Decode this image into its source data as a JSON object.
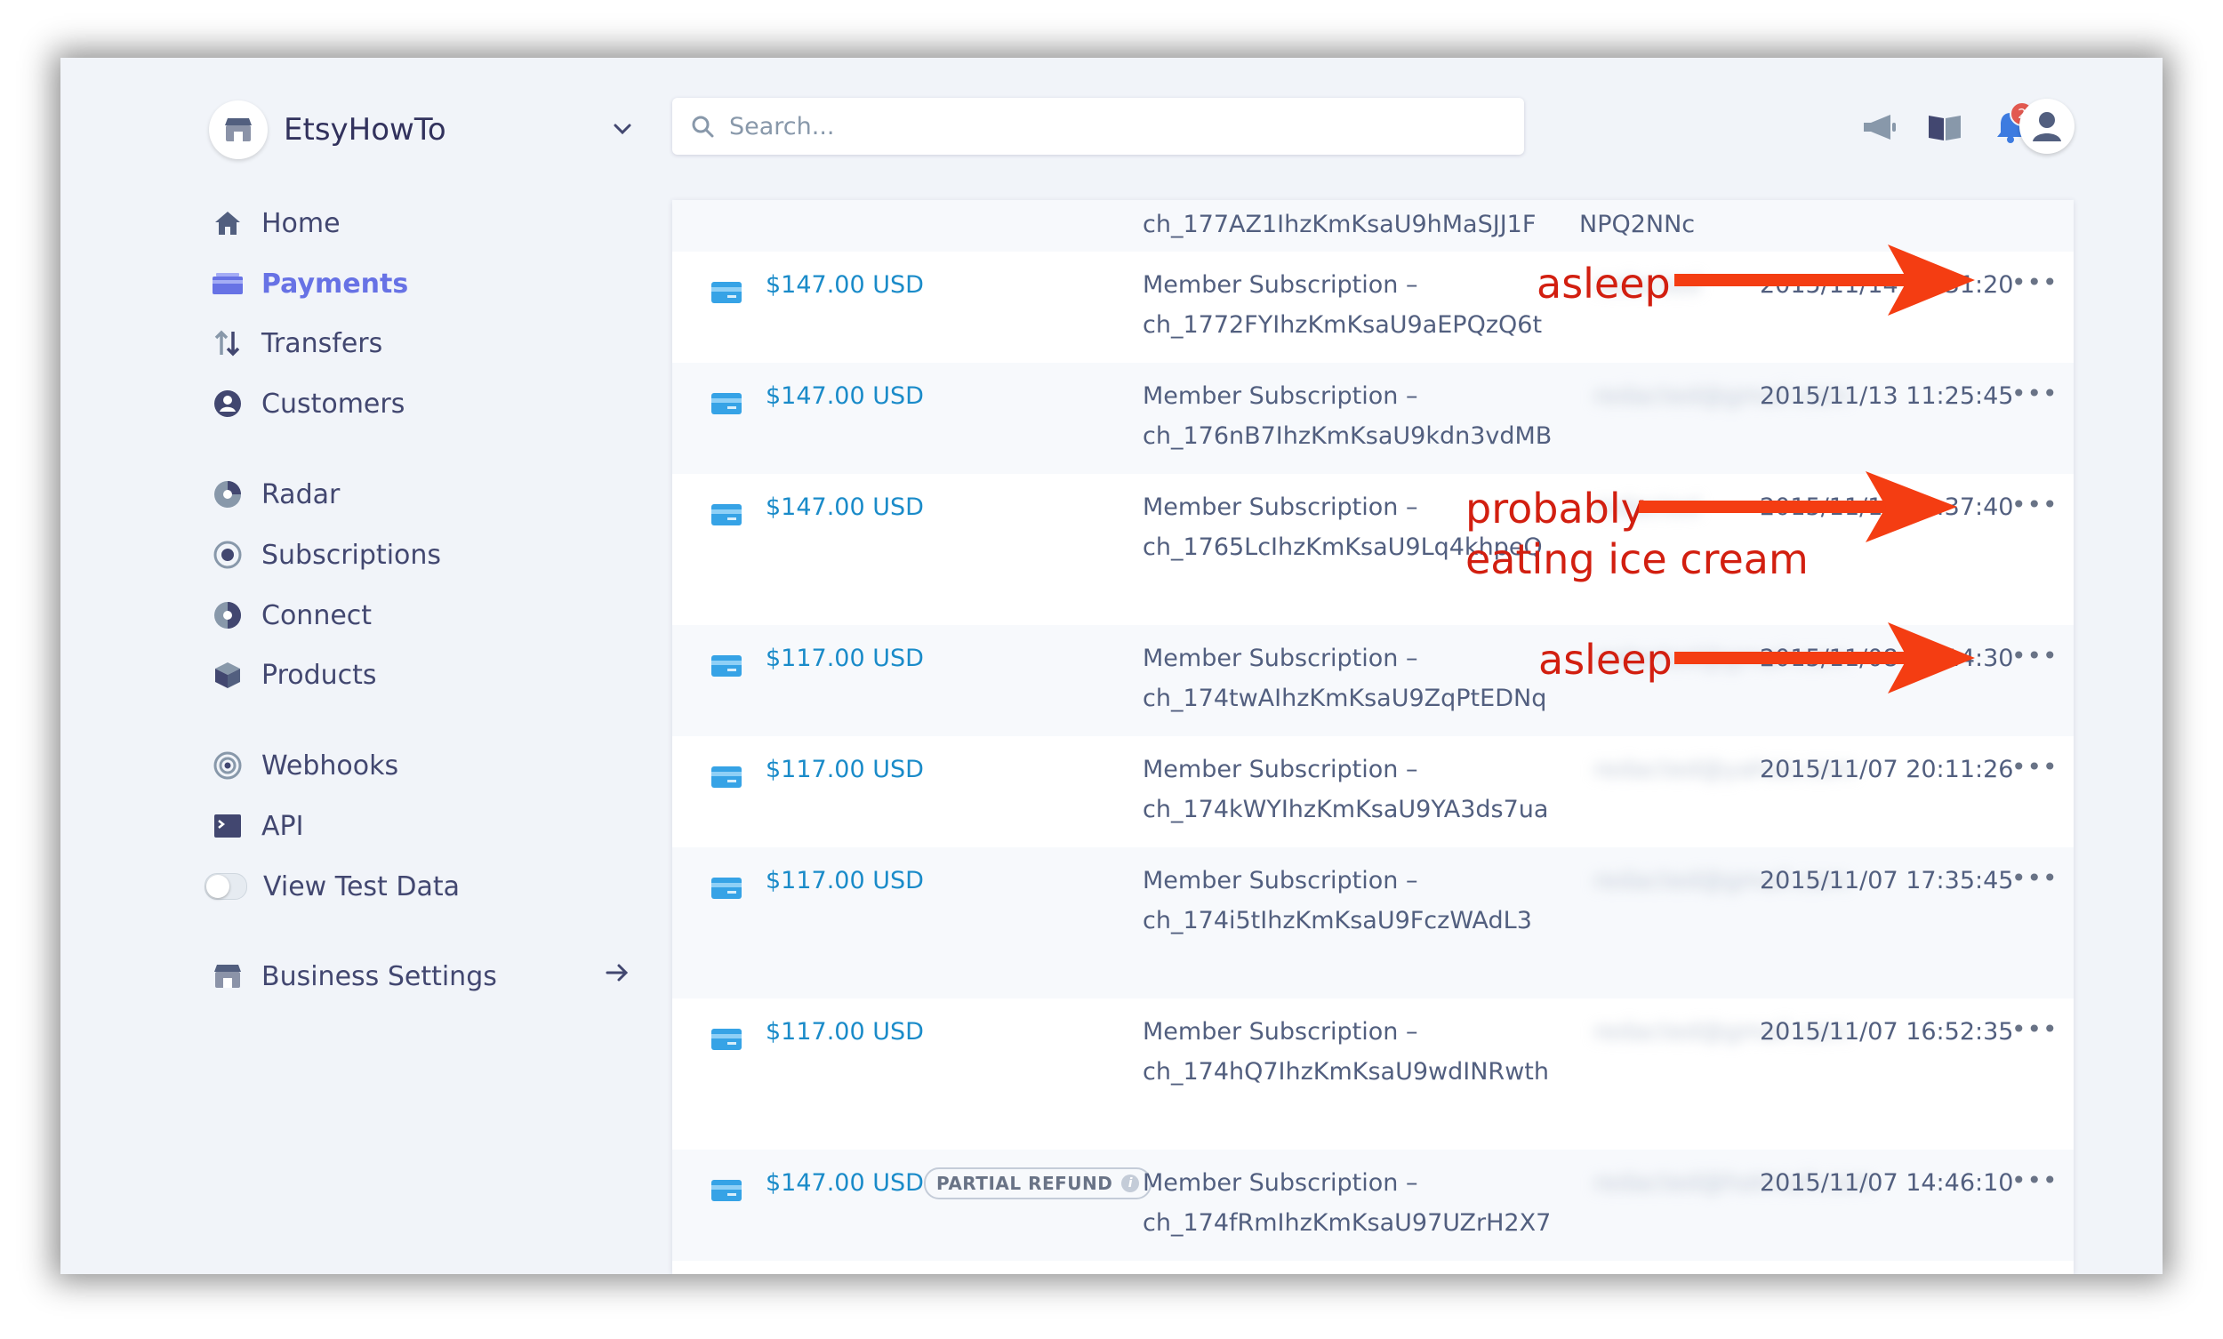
{
  "header": {
    "account_name": "EtsyHowTo",
    "search_placeholder": "Search...",
    "notification_count": "2"
  },
  "sidebar": {
    "items": [
      {
        "label": "Home",
        "icon": "home-icon"
      },
      {
        "label": "Payments",
        "icon": "payments-icon",
        "active": true
      },
      {
        "label": "Transfers",
        "icon": "transfers-icon"
      },
      {
        "label": "Customers",
        "icon": "customers-icon"
      },
      {
        "label": "Radar",
        "icon": "radar-icon"
      },
      {
        "label": "Subscriptions",
        "icon": "subscriptions-icon"
      },
      {
        "label": "Connect",
        "icon": "connect-icon"
      },
      {
        "label": "Products",
        "icon": "products-icon"
      },
      {
        "label": "Webhooks",
        "icon": "webhooks-icon"
      },
      {
        "label": "API",
        "icon": "api-icon"
      },
      {
        "label": "View Test Data",
        "icon": "toggle"
      },
      {
        "label": "Business Settings",
        "icon": "store-icon"
      }
    ]
  },
  "table": {
    "top_partial": {
      "charge_id": "ch_177AZ1IhzKmKsaU9hMaSJJ1F",
      "customer_fragment": "NPQ2NNc"
    },
    "rows": [
      {
        "amount": "$147.00 USD",
        "description": "Member Subscription –",
        "charge_id": "ch_1772FYIhzKmKsaU9aEPQzQ6t",
        "date": "2015/11/14 03:31:20",
        "customer": "redacted"
      },
      {
        "amount": "$147.00 USD",
        "description": "Member Subscription –",
        "charge_id": "ch_176nB7IhzKmKsaU9kdn3vdMB",
        "date": "2015/11/13 11:25:45",
        "customer": "redacted@gmail.com"
      },
      {
        "amount": "$147.00 USD",
        "description": "Member Subscription –",
        "charge_id": "ch_1765LcIhzKmKsaU9Lq4khpeQ",
        "date": "2015/11/11 12:37:40",
        "customer": "redacted"
      },
      {
        "amount": "$117.00 USD",
        "description": "Member Subscription –",
        "charge_id": "ch_174twAIhzKmKsaU9ZqPtEDNq",
        "date": "2015/11/08 06:14:30",
        "customer": "redacted@gmail.com"
      },
      {
        "amount": "$117.00 USD",
        "description": "Member Subscription –",
        "charge_id": "ch_174kWYIhzKmKsaU9YA3ds7ua",
        "date": "2015/11/07 20:11:26",
        "customer": "redacted@yahoo.com"
      },
      {
        "amount": "$117.00 USD",
        "description": "Member Subscription –",
        "charge_id": "ch_174i5tIhzKmKsaU9FczWAdL3",
        "date": "2015/11/07 17:35:45",
        "customer": "redacted@gmail.com"
      },
      {
        "amount": "$117.00 USD",
        "description": "Member Subscription –",
        "charge_id": "ch_174hQ7IhzKmKsaU9wdINRwth",
        "date": "2015/11/07 16:52:35",
        "customer": "redacted@gmail.com"
      },
      {
        "amount": "$147.00 USD",
        "description": "Member Subscription –",
        "charge_id": "ch_174fRmIhzKmKsaU97UZrH2X7",
        "date": "2015/11/07 14:46:10",
        "customer": "redacted@hotmail.com",
        "badge": "PARTIAL REFUND"
      }
    ]
  },
  "annotations": {
    "note_1": "asleep",
    "note_2_line1": "probably",
    "note_2_line2": "eating ice cream",
    "note_3": "asleep",
    "color": "#d21f10"
  }
}
